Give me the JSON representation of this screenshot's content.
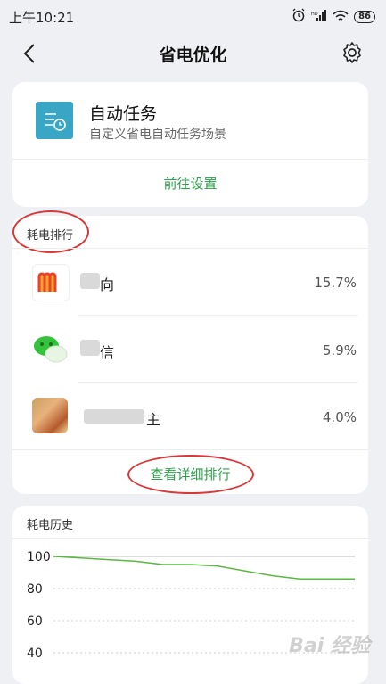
{
  "status": {
    "time": "上午10:21",
    "battery": "86"
  },
  "header": {
    "title": "省电优化"
  },
  "task_card": {
    "title": "自动任务",
    "subtitle": "自定义省电自动任务场景",
    "action": "前往设置"
  },
  "ranking": {
    "label": "耗电排行",
    "items": [
      {
        "name": "向",
        "percent": "15.7%"
      },
      {
        "name": "信",
        "percent": "5.9%"
      },
      {
        "name": "主",
        "percent": "4.0%"
      }
    ],
    "detail_link": "查看详细排行"
  },
  "history": {
    "label": "耗电历史",
    "chart_data": {
      "type": "line",
      "y_ticks": [
        "100",
        "80",
        "60",
        "40"
      ],
      "ylim": [
        40,
        100
      ],
      "series": [
        {
          "values": [
            100,
            99,
            98,
            97,
            95,
            95,
            94,
            91,
            88,
            86,
            86,
            86
          ],
          "color": "#5bb840"
        }
      ]
    }
  },
  "watermark": "Bai 经验"
}
